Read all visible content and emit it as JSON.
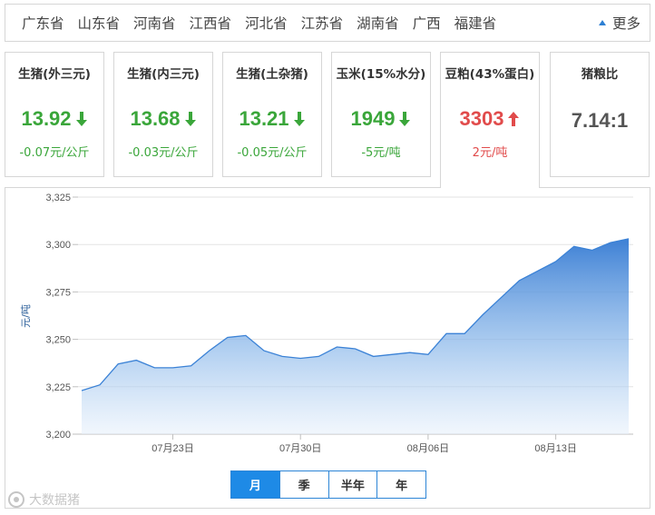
{
  "provinces": [
    "广东省",
    "山东省",
    "河南省",
    "江西省",
    "河北省",
    "江苏省",
    "湖南省",
    "广西",
    "福建省"
  ],
  "more_label": "更多",
  "cards": [
    {
      "title": "生猪(外三元)",
      "value": "13.92",
      "change": "-0.07元/公斤",
      "trend": "down"
    },
    {
      "title": "生猪(内三元)",
      "value": "13.68",
      "change": "-0.03元/公斤",
      "trend": "down"
    },
    {
      "title": "生猪(土杂猪)",
      "value": "13.21",
      "change": "-0.05元/公斤",
      "trend": "down"
    },
    {
      "title": "玉米(15%水分)",
      "value": "1949",
      "change": "-5元/吨",
      "trend": "down"
    },
    {
      "title": "豆粕(43%蛋白)",
      "value": "3303",
      "change": "2元/吨",
      "trend": "up"
    }
  ],
  "ratio_card": {
    "title": "猪粮比",
    "value": "7.14:1"
  },
  "colors": {
    "down": "#3aa63a",
    "up": "#e14b4b",
    "accent": "#1e8ae6",
    "line": "#3b82d6"
  },
  "tabs": [
    {
      "label": "月",
      "active": true
    },
    {
      "label": "季",
      "active": false
    },
    {
      "label": "半年",
      "active": false
    },
    {
      "label": "年",
      "active": false
    }
  ],
  "watermark": "大数据猪",
  "chart_data": {
    "type": "area",
    "ylabel": "元/吨",
    "ylim": [
      3200,
      3325
    ],
    "y_ticks": [
      "3,200",
      "3,225",
      "3,250",
      "3,275",
      "3,300",
      "3,325"
    ],
    "y_tick_values": [
      3200,
      3225,
      3250,
      3275,
      3300,
      3325
    ],
    "x_tick_labels": [
      "07月23日",
      "07月30日",
      "08月06日",
      "08月13日"
    ],
    "x_tick_index": [
      5,
      12,
      19,
      26
    ],
    "grid": true,
    "values": [
      3223,
      3226,
      3237,
      3239,
      3235,
      3235,
      3236,
      3244,
      3251,
      3252,
      3244,
      3241,
      3240,
      3241,
      3246,
      3245,
      3241,
      3242,
      3243,
      3242,
      3253,
      3253,
      3263,
      3272,
      3281,
      3286,
      3291,
      3299,
      3297,
      3301,
      3303
    ]
  }
}
